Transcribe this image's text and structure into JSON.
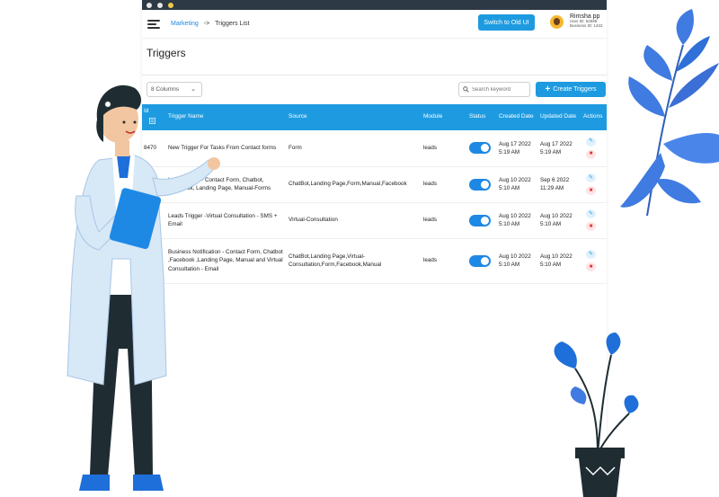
{
  "breadcrumb": {
    "parent": "Marketing",
    "separator": "->",
    "current": "Triggers List"
  },
  "header": {
    "switch_label": "Switch to Old UI",
    "user_name": "Rimsha pp",
    "user_id": "User ID: 52599",
    "business_id": "Business ID: 1422"
  },
  "page_title": "Triggers",
  "toolbar": {
    "columns_select": "8 Columns",
    "search_placeholder": "Search keyword",
    "create_label": "Create Triggers"
  },
  "table": {
    "headers": {
      "id": "Id",
      "name": "Trigger Name",
      "source": "Source",
      "module": "Module",
      "status": "Status",
      "created": "Created Date",
      "updated": "Updated Date",
      "actions": "Actions"
    },
    "rows": [
      {
        "id": "8470",
        "name": "New Trigger For Tasks From Contact forms",
        "source": "Form",
        "module": "leads",
        "status": true,
        "created": "Aug 17 2022 5:19 AM",
        "updated": "Aug 17 2022 5:19 AM"
      },
      {
        "id": "",
        "name": "Lead Trigger - Contact Form, Chatbot, Facebook, Landing Page, Manual-Forms",
        "source": "ChatBot,Landing Page,Form,Manual,Facebook",
        "module": "leads",
        "status": true,
        "created": "Aug 10 2022 5:10 AM",
        "updated": "Sep 6 2022 11:29 AM"
      },
      {
        "id": "",
        "name": "Leads Trigger -Virtual Consultation - SMS + Email",
        "source": "Virtual-Consultation",
        "module": "leads",
        "status": true,
        "created": "Aug 10 2022 5:10 AM",
        "updated": "Aug 10 2022 5:10 AM"
      },
      {
        "id": "",
        "name": "Business Notification - Contact Form, Chatbot ,Facebook ,Landing Page, Manual and Virtual Consultation - Email",
        "source": "ChatBot,Landing Page,Virtual-Consultation,Form,Facebook,Manual",
        "module": "leads",
        "status": true,
        "created": "Aug 10 2022 5:10 AM",
        "updated": "Aug 10 2022 5:10 AM"
      }
    ]
  },
  "colors": {
    "accent": "#1e9be0",
    "toggle": "#1e88e5",
    "titlebar": "#2d3a45",
    "leaf_blue": "#3f7be0",
    "coat": "#d7e8f7"
  }
}
